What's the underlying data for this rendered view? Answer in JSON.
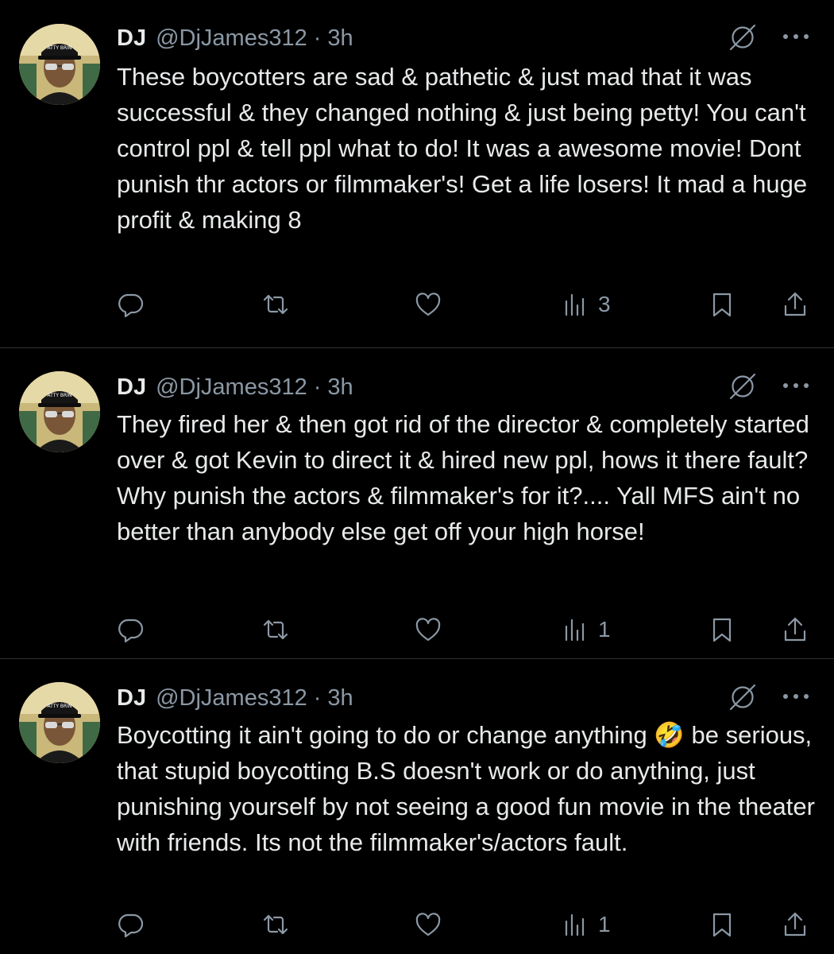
{
  "tweets": [
    {
      "name": "DJ",
      "handle": "@DjJames312",
      "separator": "·",
      "time": "3h",
      "text": "These boycotters are sad & pathetic & just mad that it was successful & they changed nothing & just being petty! You can't control ppl & tell ppl what to do! It was a awesome movie! Dont punish thr actors or filmmaker's! Get a life losers! It mad a huge profit & making 8",
      "views": "3"
    },
    {
      "name": "DJ",
      "handle": "@DjJames312",
      "separator": "·",
      "time": "3h",
      "text": "They fired her & then got rid of the director & completely started over & got Kevin to direct it & hired new ppl, hows it there fault? Why punish the actors & filmmaker's for it?.... Yall MFS ain't no better than anybody else get off your high horse!",
      "views": "1"
    },
    {
      "name": "DJ",
      "handle": "@DjJames312",
      "separator": "·",
      "time": "3h",
      "text": "Boycotting it ain't going to do or change anything 🤣 be serious, that stupid boycotting B.S doesn't work or do anything, just punishing yourself by not seeing a good fun movie in the theater with friends. Its not the filmmaker's/actors fault.",
      "views": "1"
    }
  ],
  "icons": {
    "header": [
      "grok-icon",
      "more-icon"
    ],
    "actions": [
      "reply-icon",
      "retweet-icon",
      "like-icon",
      "views-icon",
      "bookmark-icon",
      "share-icon"
    ]
  },
  "colors": {
    "background": "#000000",
    "text": "#e7e9ea",
    "secondary": "#8b98a5",
    "divider": "#2f3336"
  }
}
